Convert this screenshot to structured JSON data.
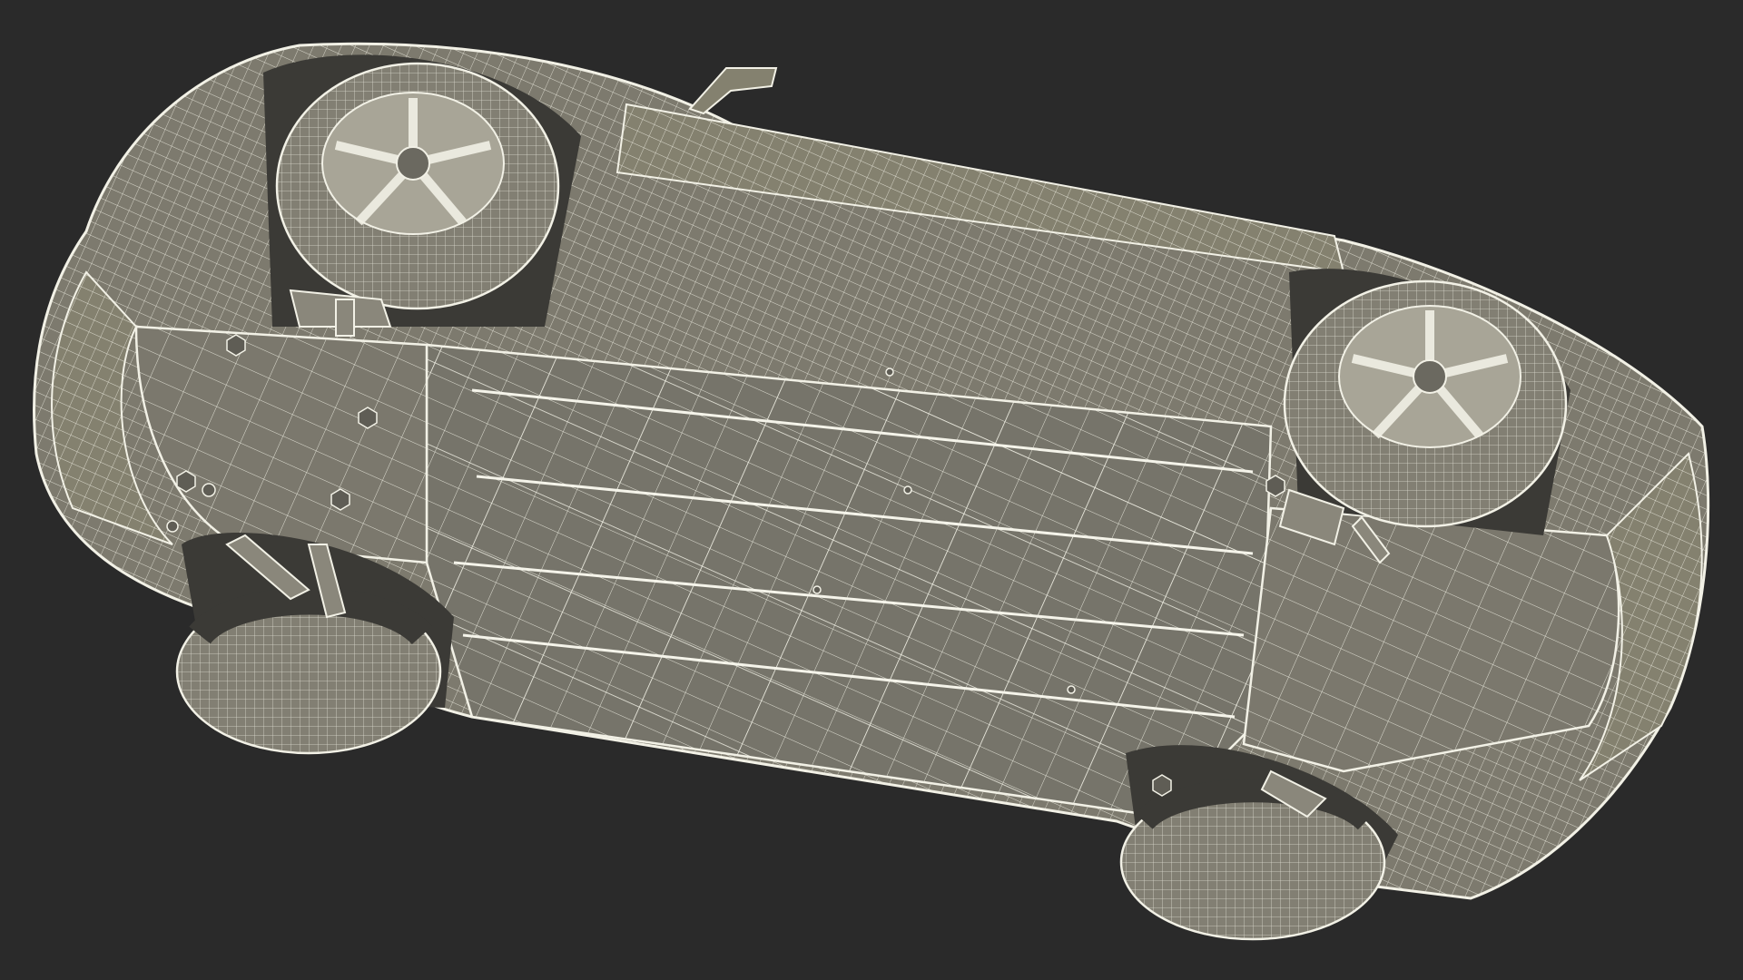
{
  "scene": {
    "background_color": "#2a2a2a",
    "body_fill": "#7d7a6e",
    "body_fill_dark": "#6b6960",
    "wire_color": "#ecebdf",
    "shadow_color": "#3b3a36",
    "tire_fill": "#827f73",
    "rim_fill": "#a8a597"
  }
}
